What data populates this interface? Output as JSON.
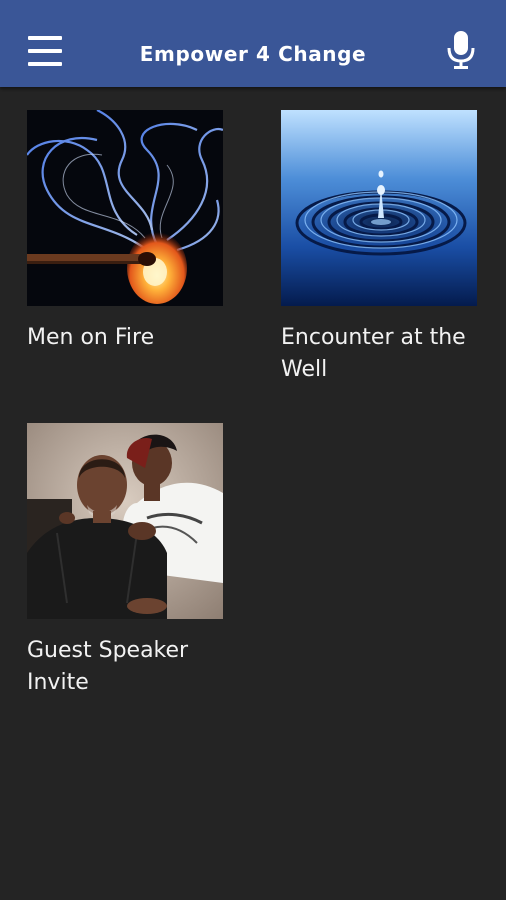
{
  "header": {
    "title": "Empower 4 Change",
    "menu_icon": "hamburger-menu-icon",
    "mic_icon": "microphone-icon",
    "background": "#3a5697"
  },
  "tiles": [
    {
      "label": "Men on Fire",
      "image": "burning-match-smoke"
    },
    {
      "label": "Encounter at the Well",
      "image": "water-drop-ripples"
    },
    {
      "label": "Guest Speaker Invite",
      "image": "couple-portrait"
    }
  ],
  "colors": {
    "background": "#242424",
    "text": "#f2f2f2"
  }
}
